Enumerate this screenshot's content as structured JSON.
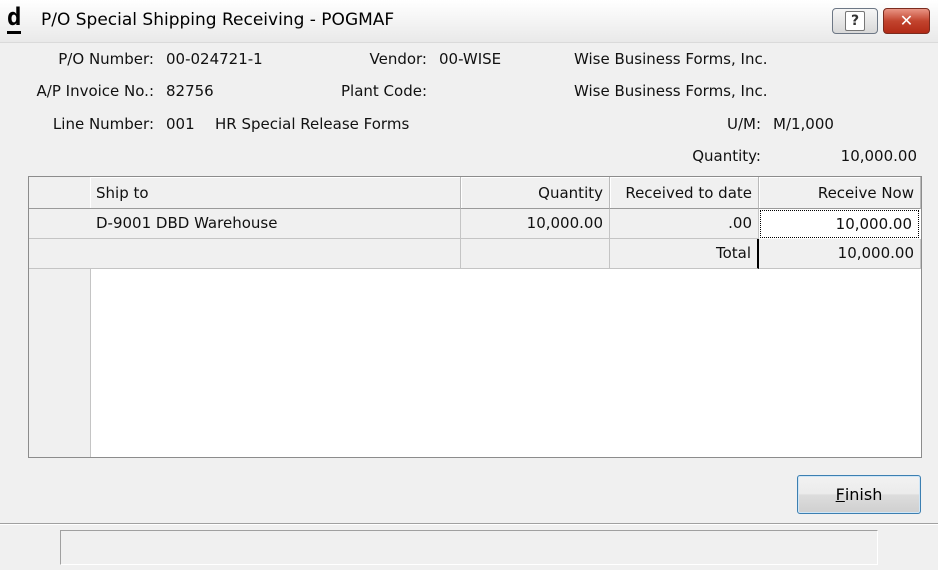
{
  "window": {
    "logo": "d",
    "title": "P/O Special Shipping Receiving - POGMAF",
    "help_glyph": "?",
    "close_glyph": "✕"
  },
  "header": {
    "po_number_label": "P/O Number:",
    "po_number": "00-024721-1",
    "vendor_label": "Vendor:",
    "vendor_code": "00-WISE",
    "vendor_name": "Wise Business Forms, Inc.",
    "invoice_label": "A/P Invoice No.:",
    "invoice_no": "82756",
    "plant_code_label": "Plant Code:",
    "plant_name": "Wise Business Forms, Inc.",
    "line_number_label": "Line Number:",
    "line_number": "001",
    "line_description": "HR Special Release Forms",
    "um_label": "U/M:",
    "um": "M/1,000",
    "quantity_label": "Quantity:",
    "quantity": "10,000.00"
  },
  "grid": {
    "columns": [
      "Ship to",
      "Quantity",
      "Received to date",
      "Receive Now"
    ],
    "rows": [
      {
        "ship_to": "D-9001 DBD Warehouse",
        "quantity": "10,000.00",
        "received_to_date": ".00",
        "receive_now": "10,000.00"
      }
    ],
    "total_label": "Total",
    "total_value": "10,000.00"
  },
  "buttons": {
    "finish_mnemonic": "F",
    "finish_rest": "inish"
  },
  "status": {
    "text": ""
  }
}
